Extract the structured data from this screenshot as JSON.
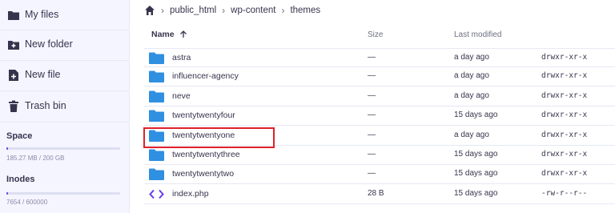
{
  "sidebar": {
    "items": [
      {
        "label": "My files",
        "icon": "folder-icon"
      },
      {
        "label": "New folder",
        "icon": "folder-plus-icon"
      },
      {
        "label": "New file",
        "icon": "file-plus-icon"
      },
      {
        "label": "Trash bin",
        "icon": "trash-icon"
      }
    ],
    "space": {
      "title": "Space",
      "text": "185.27 MB / 200 GB",
      "fraction": 0.001
    },
    "inodes": {
      "title": "Inodes",
      "text": "7654 / 600000",
      "fraction": 0.013
    }
  },
  "breadcrumb": {
    "home_icon": "home-icon",
    "items": [
      "public_html",
      "wp-content",
      "themes"
    ]
  },
  "table": {
    "headers": {
      "name": "Name",
      "size": "Size",
      "modified": "Last modified"
    },
    "rows": [
      {
        "name": "astra",
        "size": "—",
        "modified": "a day ago",
        "perms": "drwxr-xr-x",
        "type": "folder"
      },
      {
        "name": "influencer-agency",
        "size": "—",
        "modified": "a day ago",
        "perms": "drwxr-xr-x",
        "type": "folder"
      },
      {
        "name": "neve",
        "size": "—",
        "modified": "a day ago",
        "perms": "drwxr-xr-x",
        "type": "folder"
      },
      {
        "name": "twentytwentyfour",
        "size": "—",
        "modified": "15 days ago",
        "perms": "drwxr-xr-x",
        "type": "folder"
      },
      {
        "name": "twentytwentyone",
        "size": "—",
        "modified": "a day ago",
        "perms": "drwxr-xr-x",
        "type": "folder"
      },
      {
        "name": "twentytwentythree",
        "size": "—",
        "modified": "15 days ago",
        "perms": "drwxr-xr-x",
        "type": "folder"
      },
      {
        "name": "twentytwentytwo",
        "size": "—",
        "modified": "15 days ago",
        "perms": "drwxr-xr-x",
        "type": "folder"
      },
      {
        "name": "index.php",
        "size": "28 B",
        "modified": "15 days ago",
        "perms": "-rw-r--r--",
        "type": "code"
      }
    ]
  },
  "colors": {
    "accent": "#673de6",
    "folder": "#2f8fe0",
    "highlight": "#e0202a"
  }
}
